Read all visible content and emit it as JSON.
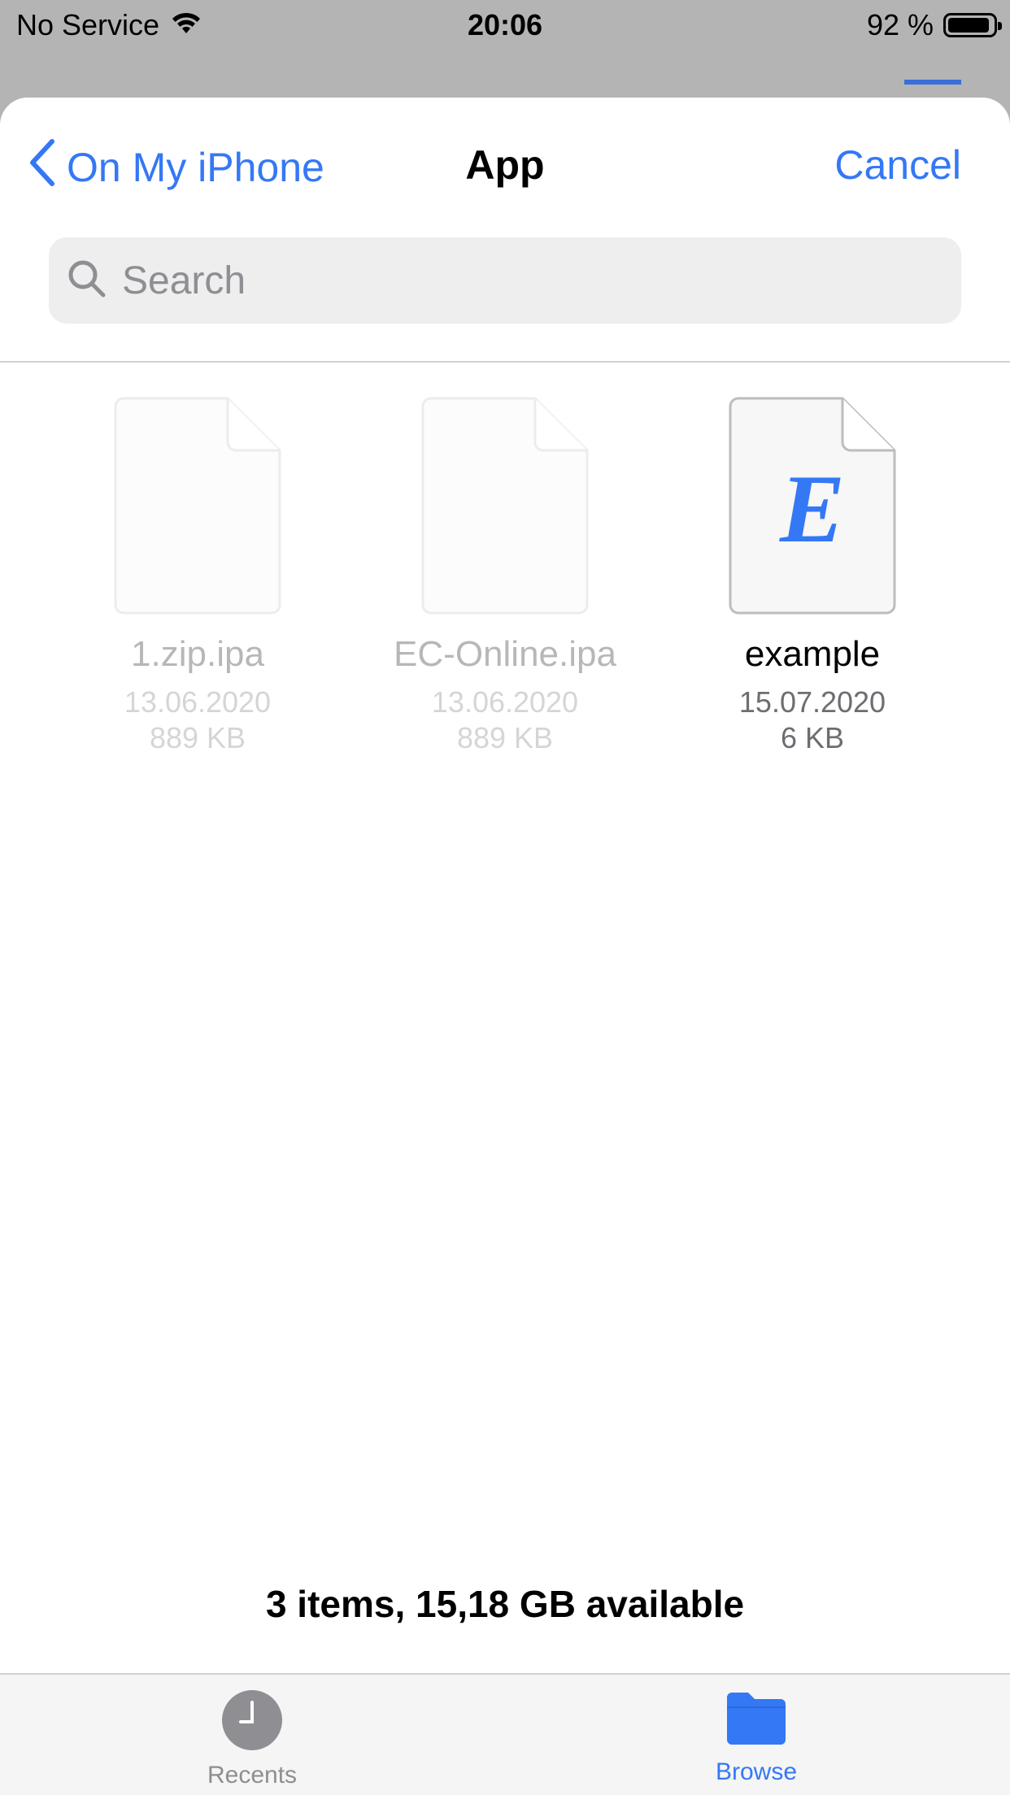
{
  "status_bar": {
    "carrier": "No Service",
    "time": "20:06",
    "battery_percent": "92 %",
    "battery_level": 0.92
  },
  "sheet": {
    "back_label": "On My iPhone",
    "title": "App",
    "cancel_label": "Cancel",
    "search_placeholder": "Search"
  },
  "files": [
    {
      "name": "1.zip.ipa",
      "date": "13.06.2020",
      "size": "889 KB",
      "enabled": false,
      "icon": "generic-document-icon"
    },
    {
      "name": "EC-Online.ipa",
      "date": "13.06.2020",
      "size": "889 KB",
      "enabled": false,
      "icon": "generic-document-icon"
    },
    {
      "name": "example",
      "date": "15.07.2020",
      "size": "6 KB",
      "enabled": true,
      "icon": "e-document-icon",
      "icon_letter": "E"
    }
  ],
  "summary": "3 items, 15,18 GB available",
  "tabs": [
    {
      "label": "Recents",
      "icon": "clock-icon",
      "selected": false
    },
    {
      "label": "Browse",
      "icon": "folder-icon",
      "selected": true
    }
  ],
  "colors": {
    "accent": "#3478f6",
    "text_secondary": "#6d6d72"
  }
}
